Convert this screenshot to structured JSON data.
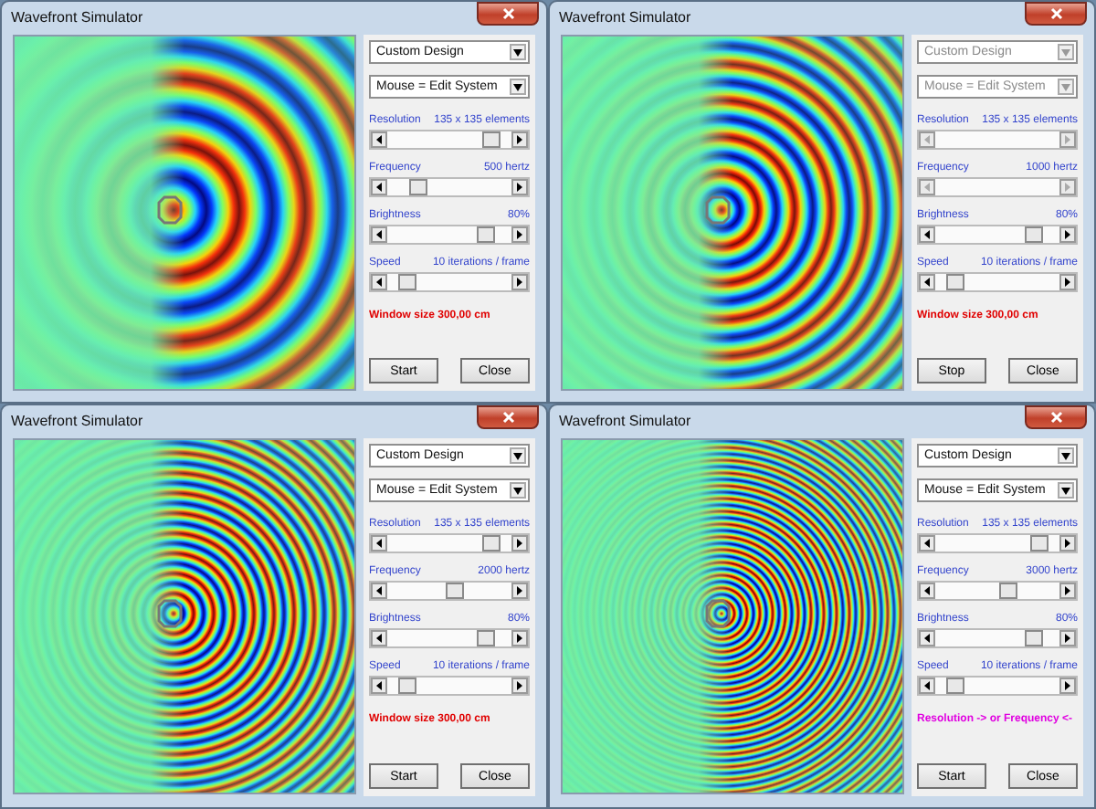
{
  "windows": [
    {
      "title": "Wavefront Simulator",
      "design_select": {
        "value": "Custom Design",
        "disabled": false
      },
      "mouse_select": {
        "value": "Mouse = Edit System",
        "disabled": false
      },
      "sliders": [
        {
          "label": "Resolution",
          "reading": "135 x 135 elements",
          "level": 0.9,
          "disabled": false
        },
        {
          "label": "Frequency",
          "reading": "500 hertz",
          "level": 0.2,
          "disabled": false
        },
        {
          "label": "Brightness",
          "reading": "80%",
          "level": 0.85,
          "disabled": false
        },
        {
          "label": "Speed",
          "reading": "10 iterations / frame",
          "level": 0.1,
          "disabled": false
        }
      ],
      "message": {
        "text": "Window size 300,00 cm",
        "color": "#e00000"
      },
      "buttons": [
        {
          "label": "Start"
        },
        {
          "label": "Close"
        }
      ]
    },
    {
      "title": "Wavefront Simulator",
      "design_select": {
        "value": "Custom Design",
        "disabled": true
      },
      "mouse_select": {
        "value": "Mouse = Edit System",
        "disabled": true
      },
      "sliders": [
        {
          "label": "Resolution",
          "reading": "135 x 135 elements",
          "disabled": true
        },
        {
          "label": "Frequency",
          "reading": "1000 hertz",
          "disabled": true
        },
        {
          "label": "Brightness",
          "reading": "80%",
          "level": 0.85,
          "disabled": false
        },
        {
          "label": "Speed",
          "reading": "10 iterations / frame",
          "level": 0.1,
          "disabled": false
        }
      ],
      "message": {
        "text": "Window size 300,00 cm",
        "color": "#e00000"
      },
      "buttons": [
        {
          "label": "Stop"
        },
        {
          "label": "Close"
        }
      ]
    },
    {
      "title": "Wavefront Simulator",
      "design_select": {
        "value": "Custom Design",
        "disabled": false
      },
      "mouse_select": {
        "value": "Mouse = Edit System",
        "disabled": false
      },
      "sliders": [
        {
          "label": "Resolution",
          "reading": "135 x 135 elements",
          "level": 0.9,
          "disabled": false
        },
        {
          "label": "Frequency",
          "reading": "2000 hertz",
          "level": 0.55,
          "disabled": false
        },
        {
          "label": "Brightness",
          "reading": "80%",
          "level": 0.85,
          "disabled": false
        },
        {
          "label": "Speed",
          "reading": "10 iterations / frame",
          "level": 0.1,
          "disabled": false
        }
      ],
      "message": {
        "text": "Window size 300,00 cm",
        "color": "#e00000"
      },
      "buttons": [
        {
          "label": "Start"
        },
        {
          "label": "Close"
        }
      ]
    },
    {
      "title": "Wavefront Simulator",
      "design_select": {
        "value": "Custom Design",
        "disabled": false
      },
      "mouse_select": {
        "value": "Mouse = Edit System",
        "disabled": false
      },
      "sliders": [
        {
          "label": "Resolution",
          "reading": "135 x 135 elements",
          "level": 0.9,
          "disabled": false
        },
        {
          "label": "Frequency",
          "reading": "3000 hertz",
          "level": 0.6,
          "disabled": false
        },
        {
          "label": "Brightness",
          "reading": "80%",
          "level": 0.85,
          "disabled": false
        },
        {
          "label": "Speed",
          "reading": "10 iterations / frame",
          "level": 0.1,
          "disabled": false
        }
      ],
      "message": {
        "text": "Resolution -> or Frequency <-",
        "color": "#e000e0"
      },
      "buttons": [
        {
          "label": "Start"
        },
        {
          "label": "Close"
        }
      ]
    }
  ]
}
